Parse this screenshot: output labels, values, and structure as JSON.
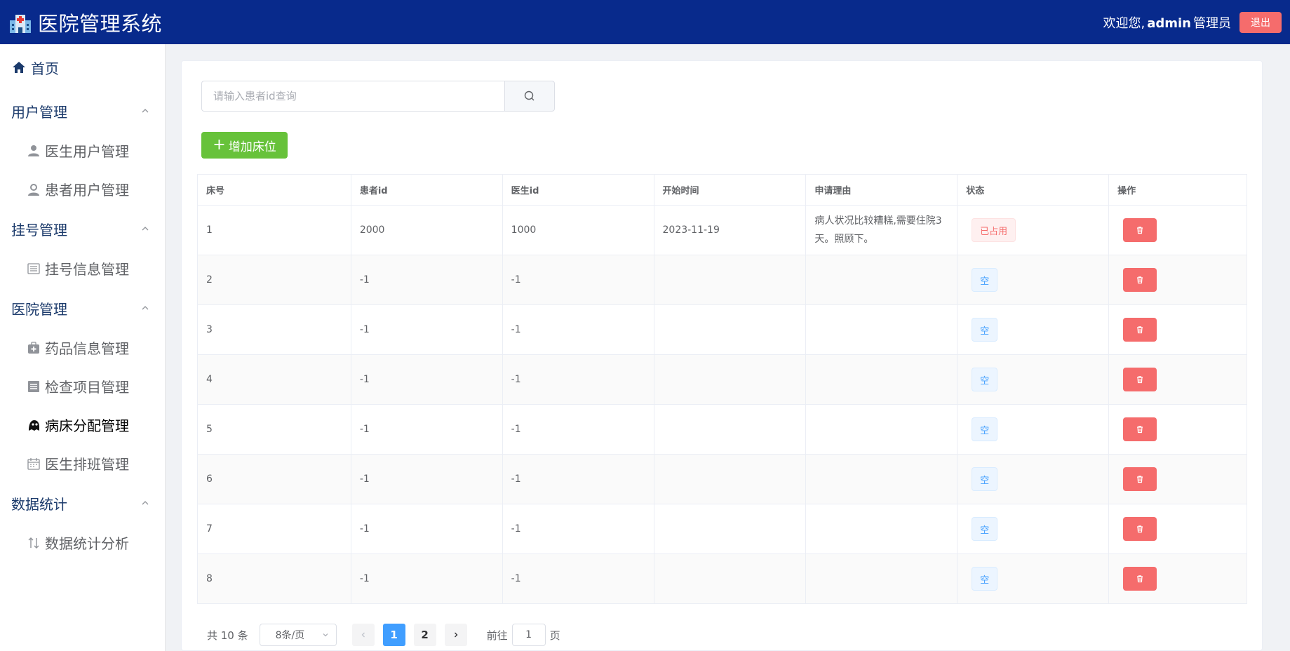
{
  "header": {
    "title": "医院管理系统",
    "welcome_prefix": "欢迎您,",
    "username": "admin",
    "role": "管理员",
    "logout_label": "退出"
  },
  "sidebar": {
    "home": "首页",
    "groups": [
      {
        "title": "用户管理",
        "items": [
          "医生用户管理",
          "患者用户管理"
        ]
      },
      {
        "title": "挂号管理",
        "items": [
          "挂号信息管理"
        ]
      },
      {
        "title": "医院管理",
        "items": [
          "药品信息管理",
          "检查项目管理",
          "病床分配管理",
          "医生排班管理"
        ]
      },
      {
        "title": "数据统计",
        "items": [
          "数据统计分析"
        ]
      }
    ],
    "active_item": "病床分配管理"
  },
  "search": {
    "placeholder": "请输入患者id查询",
    "value": ""
  },
  "add_button_label": "增加床位",
  "table": {
    "headers": [
      "床号",
      "患者id",
      "医生id",
      "开始时间",
      "申请理由",
      "状态",
      "操作"
    ],
    "rows": [
      {
        "bed": "1",
        "patient_id": "2000",
        "doctor_id": "1000",
        "start_time": "2023-11-19",
        "reason": "病人状况比较糟糕,需要住院3天。照顾下。",
        "status": "已占用",
        "status_type": "occupied"
      },
      {
        "bed": "2",
        "patient_id": "-1",
        "doctor_id": "-1",
        "start_time": "",
        "reason": "",
        "status": "空",
        "status_type": "empty"
      },
      {
        "bed": "3",
        "patient_id": "-1",
        "doctor_id": "-1",
        "start_time": "",
        "reason": "",
        "status": "空",
        "status_type": "empty"
      },
      {
        "bed": "4",
        "patient_id": "-1",
        "doctor_id": "-1",
        "start_time": "",
        "reason": "",
        "status": "空",
        "status_type": "empty"
      },
      {
        "bed": "5",
        "patient_id": "-1",
        "doctor_id": "-1",
        "start_time": "",
        "reason": "",
        "status": "空",
        "status_type": "empty"
      },
      {
        "bed": "6",
        "patient_id": "-1",
        "doctor_id": "-1",
        "start_time": "",
        "reason": "",
        "status": "空",
        "status_type": "empty"
      },
      {
        "bed": "7",
        "patient_id": "-1",
        "doctor_id": "-1",
        "start_time": "",
        "reason": "",
        "status": "空",
        "status_type": "empty"
      },
      {
        "bed": "8",
        "patient_id": "-1",
        "doctor_id": "-1",
        "start_time": "",
        "reason": "",
        "status": "空",
        "status_type": "empty"
      }
    ]
  },
  "pagination": {
    "total_text": "共 10 条",
    "page_size": "8条/页",
    "pages": [
      "1",
      "2"
    ],
    "current_page": "1",
    "goto_prefix": "前往",
    "goto_value": "1",
    "goto_suffix": "页"
  },
  "colors": {
    "header_bg": "#082a8c",
    "success": "#67c23a",
    "danger": "#f56c6c",
    "primary": "#409eff"
  }
}
